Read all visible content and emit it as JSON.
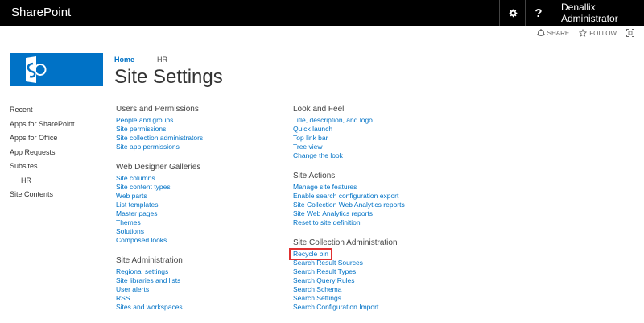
{
  "topbar": {
    "brand": "SharePoint",
    "user": "Denallix Administrator",
    "help": "?"
  },
  "actions": {
    "share": "SHARE",
    "follow": "FOLLOW"
  },
  "breadcrumb": {
    "home": "Home",
    "current": "HR"
  },
  "page_title": "Site Settings",
  "leftnav": [
    "Recent",
    "Apps for SharePoint",
    "Apps for Office",
    "App Requests",
    "Subsites",
    "HR",
    "Site Contents"
  ],
  "columns": {
    "left": [
      {
        "heading": "Users and Permissions",
        "links": [
          "People and groups",
          "Site permissions",
          "Site collection administrators",
          "Site app permissions"
        ]
      },
      {
        "heading": "Web Designer Galleries",
        "links": [
          "Site columns",
          "Site content types",
          "Web parts",
          "List templates",
          "Master pages",
          "Themes",
          "Solutions",
          "Composed looks"
        ]
      },
      {
        "heading": "Site Administration",
        "links": [
          "Regional settings",
          "Site libraries and lists",
          "User alerts",
          "RSS",
          "Sites and workspaces"
        ]
      }
    ],
    "right": [
      {
        "heading": "Look and Feel",
        "links": [
          "Title, description, and logo",
          "Quick launch",
          "Top link bar",
          "Tree view",
          "Change the look"
        ]
      },
      {
        "heading": "Site Actions",
        "links": [
          "Manage site features",
          "Enable search configuration export",
          "Site Collection Web Analytics reports",
          "Site Web Analytics reports",
          "Reset to site definition"
        ]
      },
      {
        "heading": "Site Collection Administration",
        "links": [
          "Recycle bin",
          "Search Result Sources",
          "Search Result Types",
          "Search Query Rules",
          "Search Schema",
          "Search Settings",
          "Search Configuration Import"
        ]
      }
    ]
  },
  "colors": {
    "topbar": "#000000",
    "accent": "#0072C6",
    "highlight": "#e03030"
  },
  "icons": [
    "gear-icon",
    "help-icon",
    "share-icon",
    "follow-star-icon",
    "focus-icon",
    "sharepoint-logo"
  ]
}
